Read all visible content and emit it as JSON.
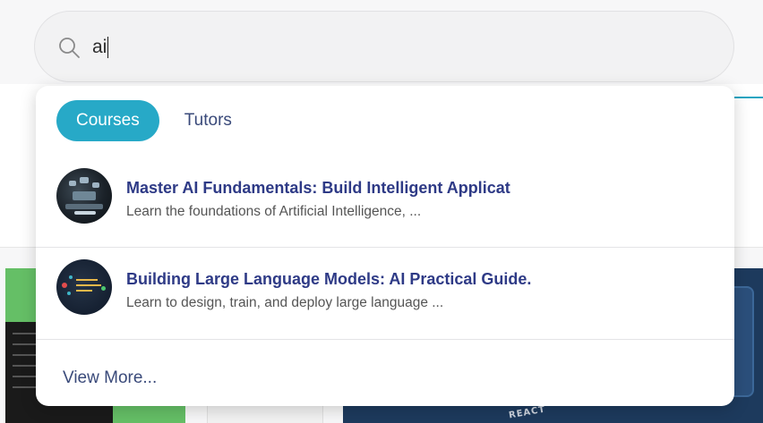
{
  "search": {
    "value": "ai",
    "icon": "search-icon"
  },
  "tabs": [
    {
      "label": "Courses",
      "active": true
    },
    {
      "label": "Tutors",
      "active": false
    }
  ],
  "results": [
    {
      "title": "Master AI Fundamentals: Build Intelligent Applicat",
      "subtitle": "Learn the foundations of Artificial Intelligence, ..."
    },
    {
      "title": "Building Large Language Models: AI Practical Guide.",
      "subtitle": "Learn to design, train, and deploy large language ..."
    }
  ],
  "view_more": "View More...",
  "background": {
    "card_label": "REACT"
  },
  "colors": {
    "accent": "#27a9c7",
    "title": "#2e3a86",
    "link": "#3a4a7a"
  }
}
